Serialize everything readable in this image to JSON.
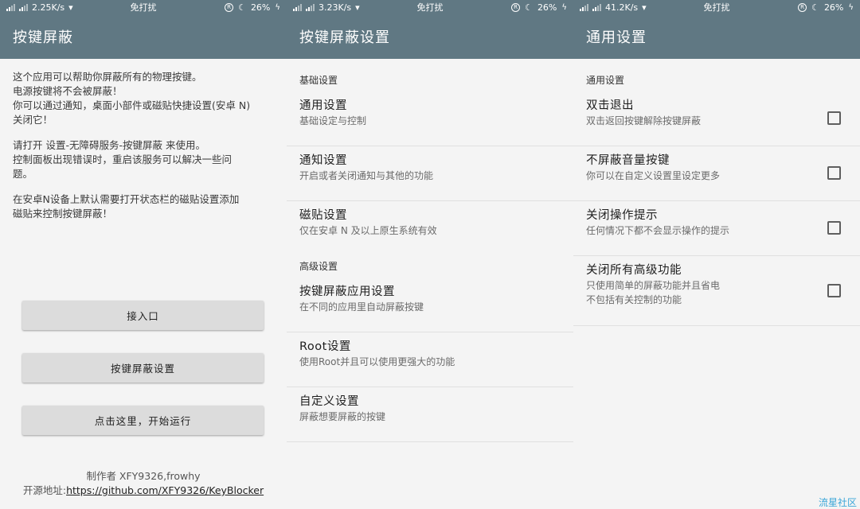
{
  "status": [
    {
      "speed": "2.25K/s",
      "center": "免打扰",
      "battery": "26%"
    },
    {
      "speed": "3.23K/s",
      "center": "免打扰",
      "battery": "26%"
    },
    {
      "speed": "41.2K/s",
      "center": "免打扰",
      "battery": "26%"
    }
  ],
  "screen1": {
    "title": "按键屏蔽",
    "intro": [
      "这个应用可以帮助你屏蔽所有的物理按键。\n电源按键将不会被屏蔽！\n你可以通过通知，桌面小部件或磁贴快捷设置(安卓 N)\n关闭它！",
      "请打开 设置-无障碍服务-按键屏蔽 来使用。\n控制面板出现错误时，重启该服务可以解决一些问\n题。",
      "在安卓N设备上默认需要打开状态栏的磁贴设置添加\n磁贴来控制按键屏蔽！"
    ],
    "buttons": [
      "接入口",
      "按键屏蔽设置",
      "点击这里，开始运行"
    ],
    "footer_author": "制作者 XFY9326,frowhy",
    "footer_source_label": "开源地址:",
    "footer_link": "https://github.com/XFY9326/KeyBlocker"
  },
  "screen2": {
    "title": "按键屏蔽设置",
    "sections": [
      {
        "title": "基础设置",
        "items": [
          {
            "title": "通用设置",
            "summary": "基础设定与控制"
          },
          {
            "title": "通知设置",
            "summary": "开启或者关闭通知与其他的功能"
          },
          {
            "title": "磁贴设置",
            "summary": "仅在安卓 N 及以上原生系统有效"
          }
        ]
      },
      {
        "title": "高级设置",
        "items": [
          {
            "title": "按键屏蔽应用设置",
            "summary": "在不同的应用里自动屏蔽按键"
          },
          {
            "title": "Root设置",
            "summary": "使用Root并且可以使用更强大的功能"
          },
          {
            "title": "自定义设置",
            "summary": "屏蔽想要屏蔽的按键"
          }
        ]
      }
    ]
  },
  "screen3": {
    "title": "通用设置",
    "section": "通用设置",
    "items": [
      {
        "title": "双击退出",
        "summary": "双击返回按键解除按键屏蔽",
        "checked": false
      },
      {
        "title": "不屏蔽音量按键",
        "summary": "你可以在自定义设置里设定更多",
        "checked": false
      },
      {
        "title": "关闭操作提示",
        "summary": "任何情况下都不会显示操作的提示",
        "checked": false
      },
      {
        "title": "关闭所有高级功能",
        "summary": "只使用简单的屏蔽功能并且省电\n不包括有关控制的功能",
        "checked": false
      }
    ]
  },
  "watermark": "流星社区",
  "colors": {
    "appbar": "#607883",
    "background": "#f4f4f4",
    "button": "#dcdcdc",
    "watermark": "#3aa6d8"
  }
}
